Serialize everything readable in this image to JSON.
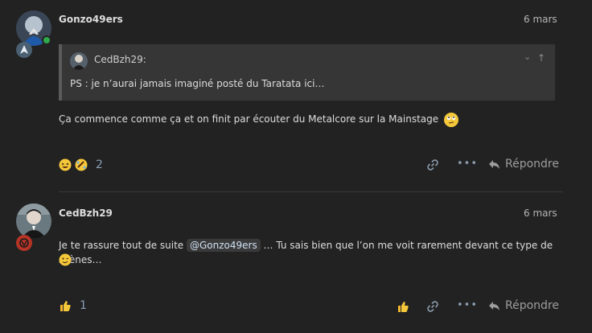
{
  "posts": [
    {
      "username": "Gonzo49ers",
      "date": "6 mars",
      "quote": {
        "author": "CedBzh29:",
        "text": "PS : je n’aurai jamais imaginé posté du Taratata ici…"
      },
      "body": "Ça commence comme ça et on finit par écouter du Metalcore sur la Mainstage",
      "reactions_count": "2",
      "reply_label": "Répondre",
      "icons": {
        "reaction_1": "laughing-emoji-icon",
        "reaction_2": "rofl-emoji-icon",
        "inline_emoji": "rolling-eyes-emoji-icon",
        "link": "link-icon",
        "more": "ellipsis-icon",
        "reply": "reply-icon"
      }
    },
    {
      "username": "CedBzh29",
      "date": "6 mars",
      "body_before": "Je te rassure tout de suite ",
      "mention": "@Gonzo49ers",
      "body_after": " … Tu sais bien que l’on me voit rarement devant ce type de scènes…",
      "likes_count": "1",
      "reply_label": "Répondre",
      "icons": {
        "inline_emoji": "winking-emoji-icon",
        "like": "thumbs-up-icon",
        "link": "link-icon",
        "more": "ellipsis-icon",
        "reply": "reply-icon"
      }
    }
  ],
  "colors": {
    "background": "#222222",
    "quote_background": "#363636",
    "online": "#2ea94c",
    "flair_red": "#c0392b"
  }
}
